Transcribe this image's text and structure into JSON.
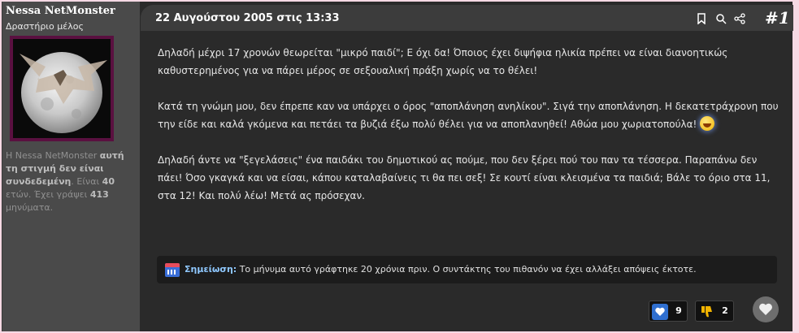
{
  "user": {
    "name": "Nessa NetMonster",
    "title": "Δραστήριο μέλος",
    "status": {
      "part1": "Η Nessa NetMonster ",
      "part2": "αυτή τη στιγμή δεν είναι συνδεδεμένη",
      "part3": ". Είναι ",
      "age": "40",
      "part4": " ετών. Έχει γράψει ",
      "posts": "413",
      "part5": " μηνύματα."
    }
  },
  "post": {
    "datetime": "22 Αυγούστου 2005 στις 13:33",
    "number": "#1",
    "paragraphs": [
      "Δηλαδή μέχρι 17 χρονών θεωρείται \"μικρό παιδί\"; Ε όχι δα! Όποιος έχει διψήφια ηλικία πρέπει να είναι διανοητικώς καθυστερημένος για να πάρει μέρος σε σεξουαλική πράξη χωρίς να το θέλει!",
      "Κατά τη γνώμη μου, δεν έπρεπε καν να υπάρχει ο όρος \"αποπλάνηση ανηλίκου\". Σιγά την αποπλάνηση. Η δεκατετράχρονη που την είδε και καλά γκόμενα και πετάει τα βυζιά έξω πολύ θέλει για να αποπλανηθεί! Αθώα μου χωριατοπούλα!",
      "Δηλαδή άντε να \"ξεγελάσεις\" ένα παιδάκι του δημοτικού ας πούμε, που δεν ξέρει πού του παν τα τέσσερα. Παραπάνω δεν πάει! Όσο γκαγκά και να είσαι, κάπου καταλαβαίνεις τι θα πει σεξ! Σε κουτί είναι κλεισμένα τα παιδιά; Βάλε το όριο στα 11, στα 12! Και πολύ λέω! Μετά ας πρόσεχαν."
    ],
    "note": {
      "label": "Σημείωση:",
      "text": " Το μήνυμα αυτό γράφτηκε 20 χρόνια πριν. Ο συντάκτης του πιθανόν να έχει αλλάξει απόψεις έκτοτε."
    },
    "reactions": {
      "likes": "9",
      "dislikes": "2"
    }
  },
  "icons": {
    "bookmark": "bookmark-icon",
    "search": "search-icon",
    "share": "share-icon",
    "calendar": "calendar-icon",
    "like": "heart-icon",
    "dislike": "thumbs-down-icon",
    "favorite": "heart-icon",
    "emoji": "laughing-emoji-icon"
  },
  "colors": {
    "page_bg": "#f6d9e4",
    "sidebar_bg": "#4a4a4a",
    "post_bg": "#2a2a2a",
    "header_bg": "#3c3c3c",
    "note_label": "#8fc8ff",
    "like_blue": "#2f6fd0",
    "dislike_yellow": "#f2b400"
  }
}
